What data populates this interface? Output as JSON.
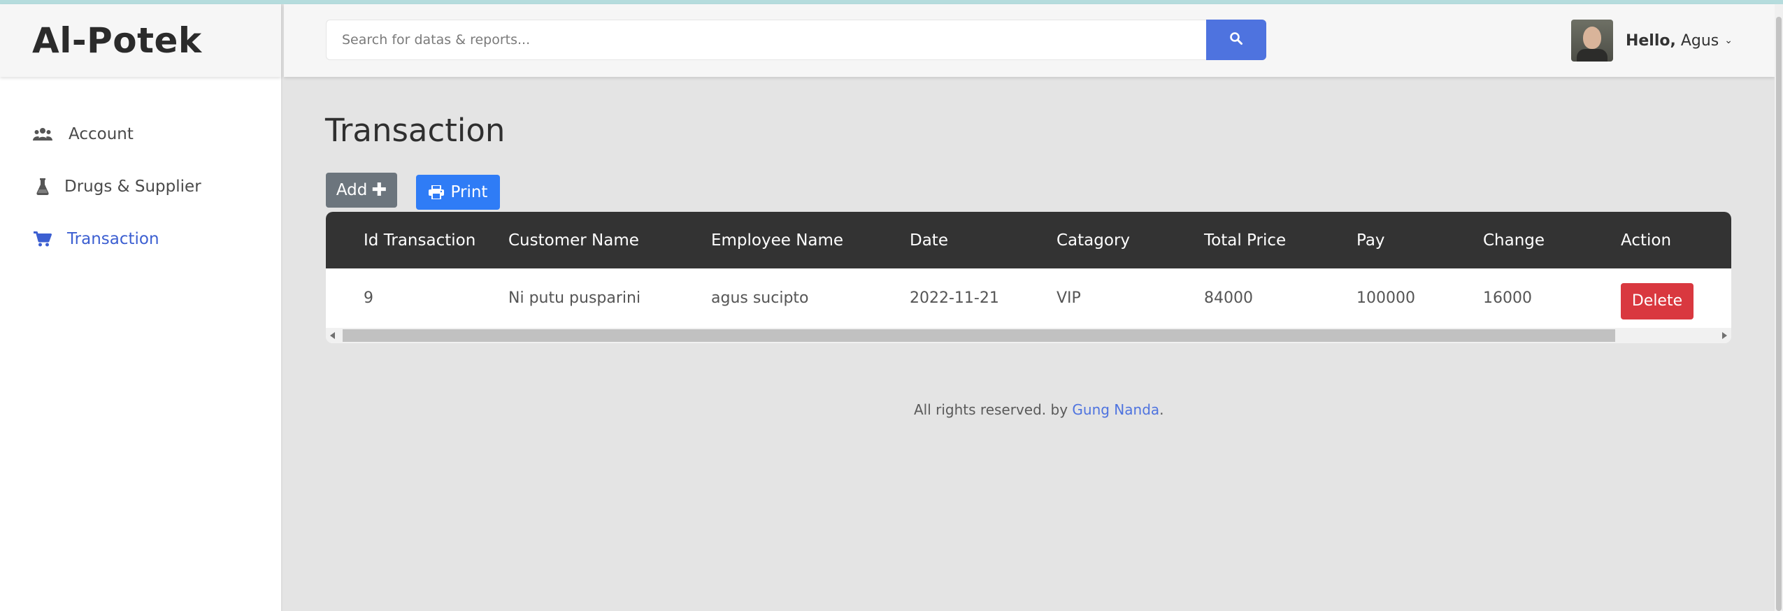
{
  "app": {
    "brand": "Al-Potek"
  },
  "sidebar": {
    "items": [
      {
        "label": "Account",
        "icon": "users-icon",
        "active": false
      },
      {
        "label": "Drugs & Supplier",
        "icon": "flask-icon",
        "active": false
      },
      {
        "label": "Transaction",
        "icon": "cart-icon",
        "active": true
      }
    ]
  },
  "header": {
    "search_placeholder": "Search for datas & reports...",
    "greeting_bold": "Hello,",
    "greeting_name": " Agus",
    "chevron": "⌄"
  },
  "main": {
    "title": "Transaction",
    "add_label": "Add",
    "add_icon": "✚",
    "print_label": "Print"
  },
  "table": {
    "columns": [
      "Id Transaction",
      "Customer Name",
      "Employee Name",
      "Date",
      "Catagory",
      "Total Price",
      "Pay",
      "Change",
      "Action"
    ],
    "rows": [
      {
        "id": "9",
        "customer": "Ni putu pusparini",
        "employee": "agus sucipto",
        "date": "2022-11-21",
        "category": "VIP",
        "total": "84000",
        "pay": "100000",
        "change": "16000",
        "action": "Delete"
      }
    ]
  },
  "footer": {
    "prefix": "All rights reserved. by ",
    "link": "Gung Nanda",
    "suffix": "."
  },
  "colors": {
    "accent": "#4e73df",
    "print": "#2f7cf6",
    "danger": "#d9383f",
    "table_header": "#333333",
    "secondary": "#6c757d"
  }
}
